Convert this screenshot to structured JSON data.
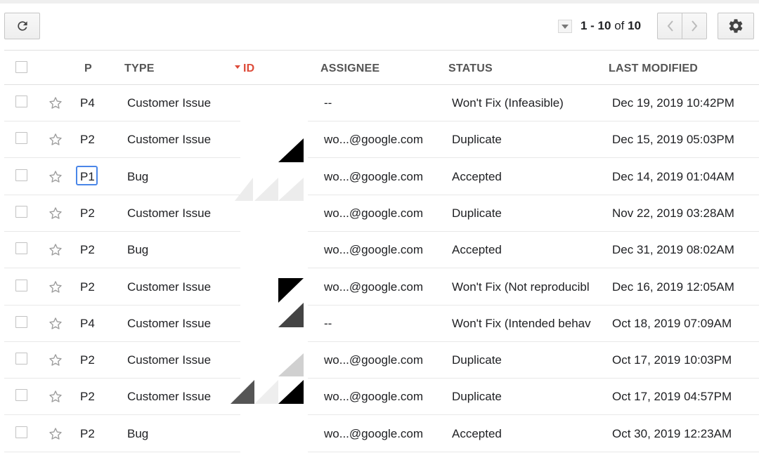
{
  "pagination": {
    "range": "1 - 10",
    "of_label": "of",
    "total": "10"
  },
  "icons": {
    "refresh": "refresh-icon",
    "prev": "chevron-left-icon",
    "next": "chevron-right-icon",
    "settings": "gear-icon",
    "dropdown": "caret-down-icon",
    "star": "star-outline-icon"
  },
  "colors": {
    "sort_accent": "#dd4b39",
    "focus_ring": "#4a86e8"
  },
  "columns": {
    "priority": "P",
    "type": "TYPE",
    "id": "ID",
    "assignee": "ASSIGNEE",
    "status": "STATUS",
    "last_modified": "LAST MODIFIED"
  },
  "rows": [
    {
      "priority": "P4",
      "type": "Customer Issue",
      "assignee": "--",
      "status": "Won't Fix (Infeasible)",
      "modified": "Dec 19, 2019 10:42PM"
    },
    {
      "priority": "P2",
      "type": "Customer Issue",
      "assignee": "wo...@google.com",
      "status": "Duplicate",
      "modified": "Dec 15, 2019 05:03PM"
    },
    {
      "priority": "P1",
      "type": "Bug",
      "assignee": "wo...@google.com",
      "status": "Accepted",
      "modified": "Dec 14, 2019 01:04AM"
    },
    {
      "priority": "P2",
      "type": "Customer Issue",
      "assignee": "wo...@google.com",
      "status": "Duplicate",
      "modified": "Nov 22, 2019 03:28AM"
    },
    {
      "priority": "P2",
      "type": "Bug",
      "assignee": "wo...@google.com",
      "status": "Accepted",
      "modified": "Dec 31, 2019 08:02AM"
    },
    {
      "priority": "P2",
      "type": "Customer Issue",
      "assignee": "wo...@google.com",
      "status": "Won't Fix (Not reproducibl",
      "modified": "Dec 16, 2019 12:05AM"
    },
    {
      "priority": "P4",
      "type": "Customer Issue",
      "assignee": "--",
      "status": "Won't Fix (Intended behav",
      "modified": "Oct 18, 2019 07:09AM"
    },
    {
      "priority": "P2",
      "type": "Customer Issue",
      "assignee": "wo...@google.com",
      "status": "Duplicate",
      "modified": "Oct 17, 2019 10:03PM"
    },
    {
      "priority": "P2",
      "type": "Customer Issue",
      "assignee": "wo...@google.com",
      "status": "Duplicate",
      "modified": "Oct 17, 2019 04:57PM"
    },
    {
      "priority": "P2",
      "type": "Bug",
      "assignee": "wo...@google.com",
      "status": "Accepted",
      "modified": "Oct 30, 2019 12:23AM"
    }
  ]
}
